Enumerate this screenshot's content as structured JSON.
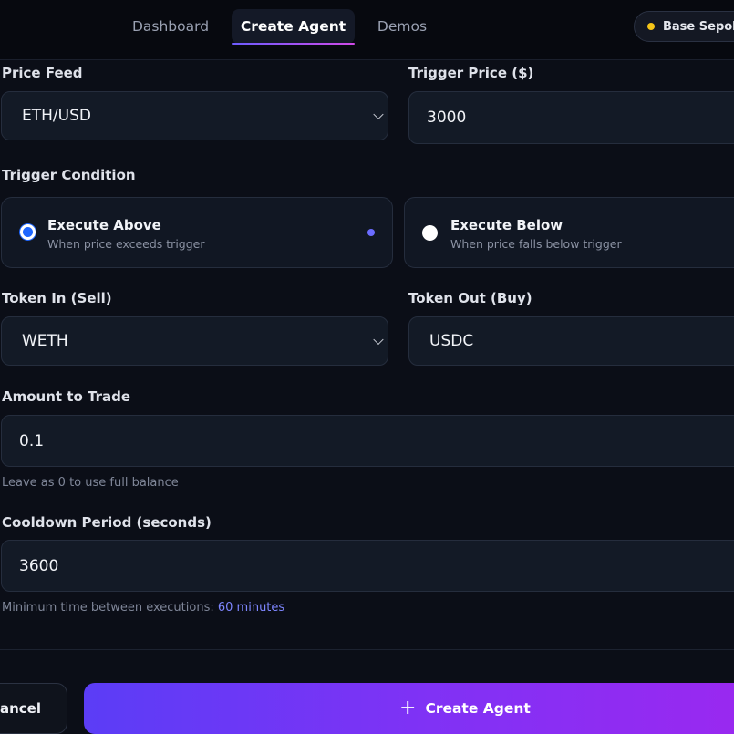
{
  "nav": {
    "tabs": [
      "Dashboard",
      "Create Agent",
      "Demos"
    ],
    "network": "Base Sepolia"
  },
  "form": {
    "price_feed": {
      "label": "Price Feed",
      "value": "ETH/USD"
    },
    "trigger_price": {
      "label": "Trigger Price ($)",
      "value": "3000"
    },
    "trigger_condition": {
      "label": "Trigger Condition",
      "options": [
        {
          "title": "Execute Above",
          "subtitle": "When price exceeds trigger",
          "selected": true
        },
        {
          "title": "Execute Below",
          "subtitle": "When price falls below trigger",
          "selected": false
        }
      ]
    },
    "token_in": {
      "label": "Token In (Sell)",
      "value": "WETH"
    },
    "token_out": {
      "label": "Token Out (Buy)",
      "value": "USDC"
    },
    "amount": {
      "label": "Amount to Trade",
      "value": "0.1",
      "hint": "Leave as 0 to use full balance"
    },
    "cooldown": {
      "label": "Cooldown Period (seconds)",
      "value": "3600",
      "hint_prefix": "Minimum time between executions: ",
      "hint_value": "60 minutes"
    }
  },
  "actions": {
    "cancel": "Cancel",
    "create": "Create Agent"
  },
  "colors": {
    "accent_start": "#5b3df6",
    "accent_end": "#9b28f0",
    "radio_on": "#1e66ff",
    "network_dot": "#f5c518"
  }
}
